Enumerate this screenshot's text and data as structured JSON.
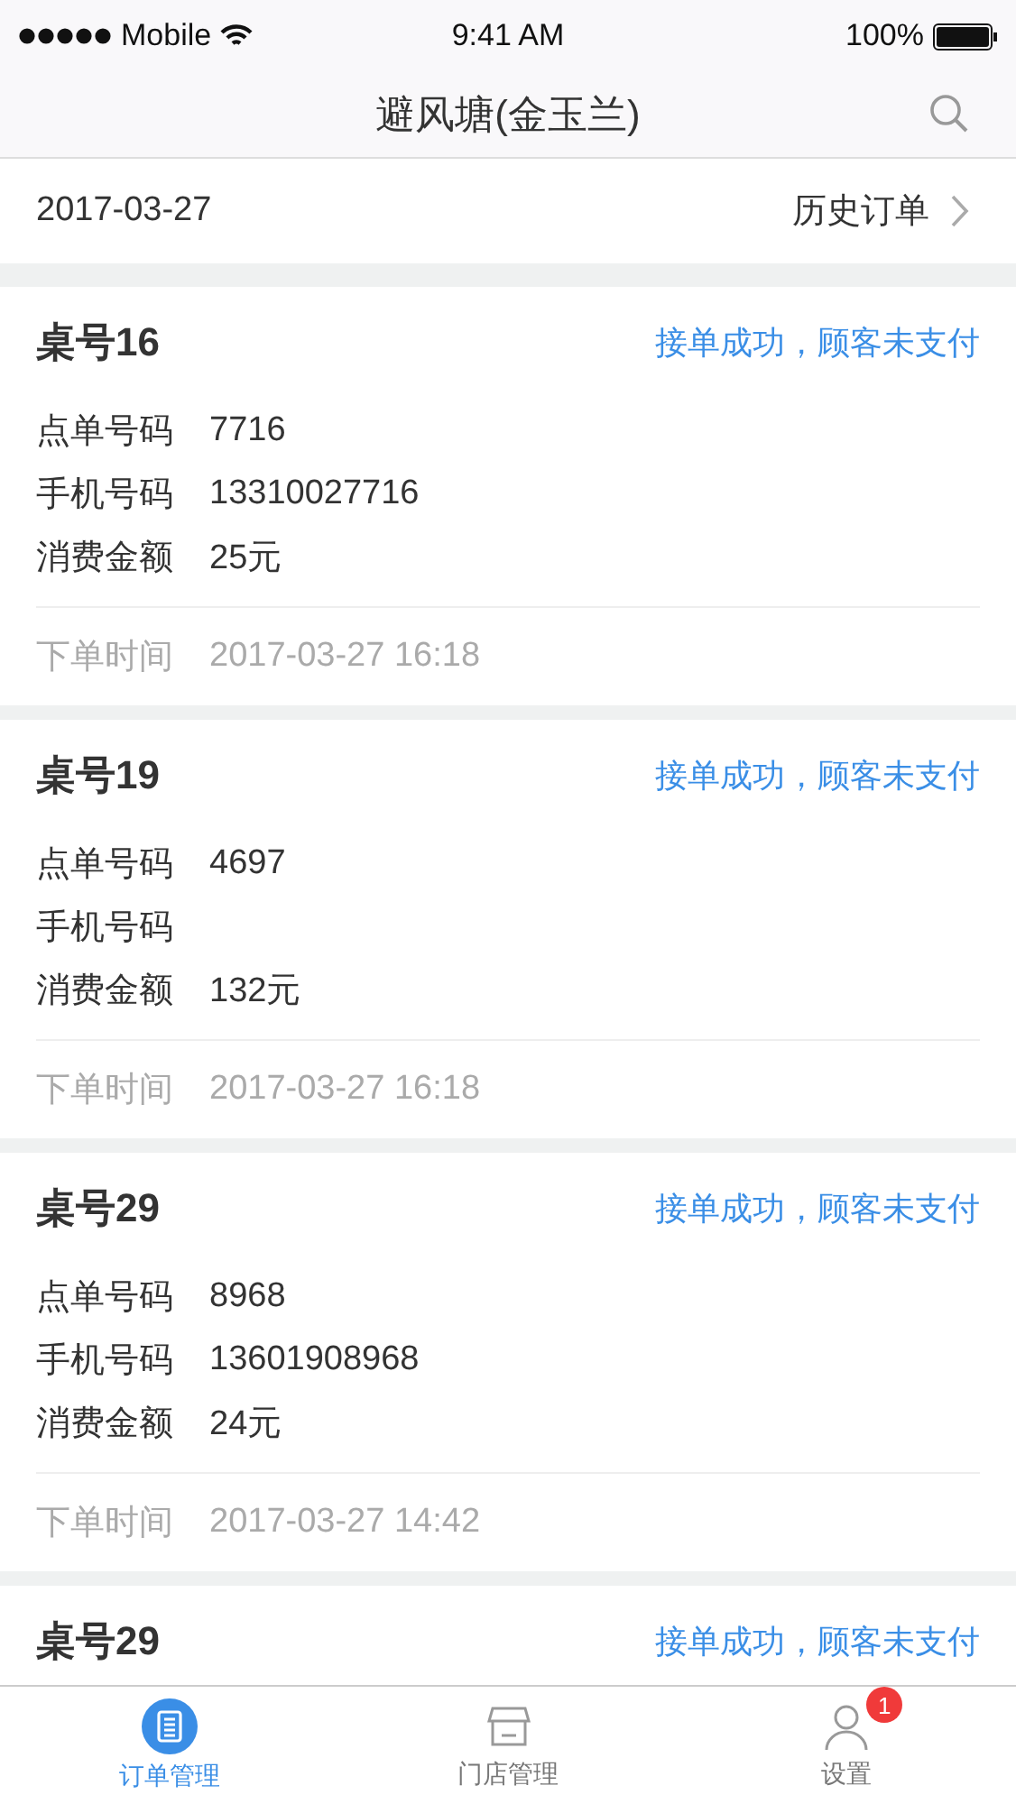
{
  "status_bar": {
    "carrier": "Mobile",
    "time": "9:41 AM",
    "battery": "100%"
  },
  "nav": {
    "title": "避风塘(金玉兰)"
  },
  "date_row": {
    "date": "2017-03-27",
    "link": "历史订单"
  },
  "orders": [
    {
      "table": "桌号16",
      "status": "接单成功，顾客未支付",
      "fields": [
        {
          "label": "点单号码",
          "value": "7716"
        },
        {
          "label": "手机号码",
          "value": "13310027716"
        },
        {
          "label": "消费金额",
          "value": "25元"
        }
      ],
      "time_label": "下单时间",
      "time": "2017-03-27 16:18"
    },
    {
      "table": "桌号19",
      "status": "接单成功，顾客未支付",
      "fields": [
        {
          "label": "点单号码",
          "value": "4697"
        },
        {
          "label": "手机号码"
        },
        {
          "label": "消费金额",
          "value": "132元"
        }
      ],
      "time_label": "下单时间",
      "time": "2017-03-27 16:18"
    },
    {
      "table": "桌号29",
      "status": "接单成功，顾客未支付",
      "fields": [
        {
          "label": "点单号码",
          "value": "8968"
        },
        {
          "label": "手机号码",
          "value": "13601908968"
        },
        {
          "label": "消费金额",
          "value": "24元"
        }
      ],
      "time_label": "下单时间",
      "time": "2017-03-27 14:42"
    },
    {
      "table": "桌号29",
      "status": "接单成功，顾客未支付"
    }
  ],
  "tabs": [
    {
      "kind": "orders",
      "label": "订单管理",
      "selected": true
    },
    {
      "kind": "store",
      "label": "门店管理",
      "selected": false
    },
    {
      "kind": "user",
      "label": "设置",
      "selected": false,
      "badge": "1"
    }
  ]
}
